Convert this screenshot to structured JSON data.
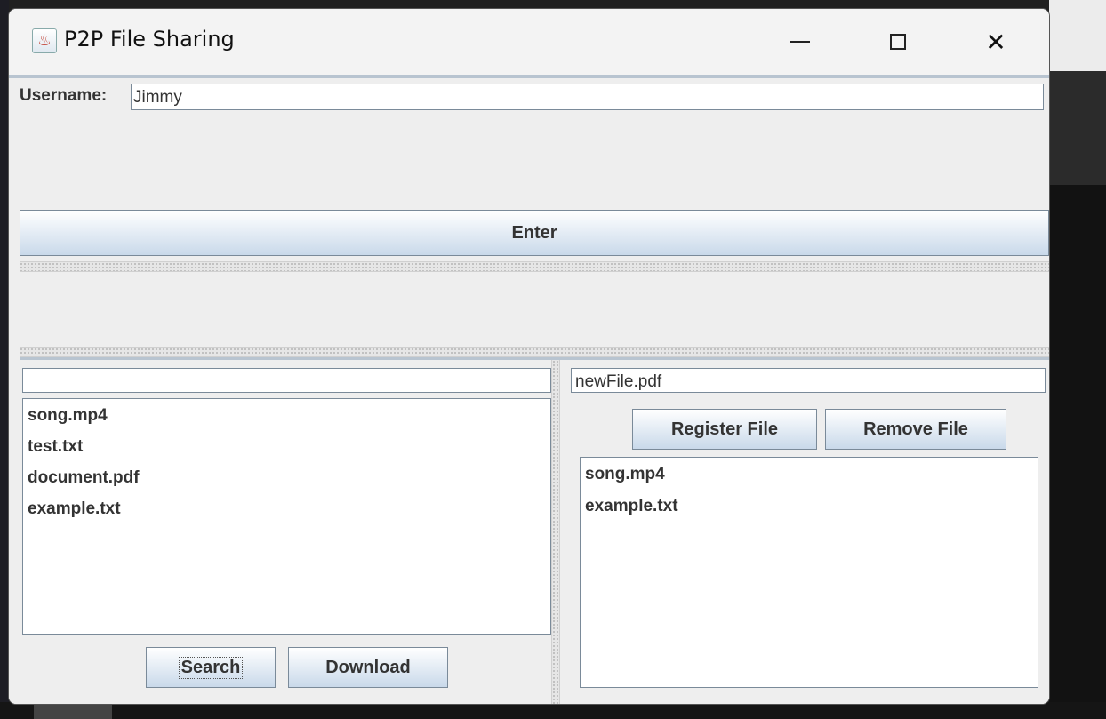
{
  "window": {
    "title": "P2P File Sharing",
    "app_icon": "java-cup-icon",
    "controls": {
      "minimize_icon": "minimize-icon",
      "maximize_icon": "maximize-icon",
      "close_icon": "close-icon",
      "close_glyph": "✕"
    }
  },
  "login": {
    "username_label": "Username:",
    "username_value": "Jimmy",
    "enter_label": "Enter"
  },
  "search_panel": {
    "search_value": "",
    "results": [
      "song.mp4",
      "test.txt",
      "document.pdf",
      "example.txt"
    ],
    "search_label": "Search",
    "download_label": "Download"
  },
  "share_panel": {
    "filename_value": "newFile.pdf",
    "register_label": "Register File",
    "remove_label": "Remove File",
    "shared_files": [
      "song.mp4",
      "example.txt"
    ]
  },
  "colors": {
    "window_bg": "#eeeeee",
    "button_gradient_top": "#ffffff",
    "button_gradient_bottom": "#c9d9ea",
    "border": "#7a8a99"
  }
}
